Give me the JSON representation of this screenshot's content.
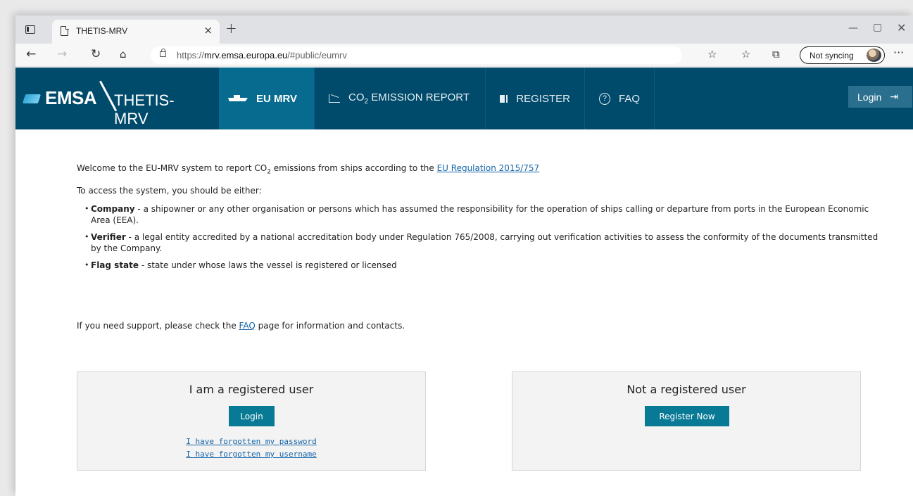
{
  "browser": {
    "tab_title": "THETIS-MRV",
    "tab_close": "×",
    "new_tab": "+",
    "url_prefix": "https://",
    "url_domain": "mrv.emsa.europa.eu",
    "url_path": "/#public/eumrv",
    "sync_label": "Not syncing",
    "icons": [
      "tab-actions-icon",
      "page-icon",
      "back-icon",
      "forward-icon",
      "refresh-icon",
      "home-icon",
      "lock-icon",
      "add-favorite-icon",
      "favorites-icon",
      "collections-icon",
      "more-icon"
    ]
  },
  "header": {
    "logo_text": "EMSA",
    "app_name": "THETIS-MRV",
    "menu": [
      {
        "label": "EU MRV",
        "active": true
      },
      {
        "label_main": "CO",
        "label_sub": "2",
        "label_rest": " EMISSION REPORT"
      },
      {
        "label": "REGISTER"
      },
      {
        "label": "FAQ"
      }
    ],
    "login_label": "Login",
    "brand_color": "#004a6b",
    "active_color": "#066b8f"
  },
  "content": {
    "welcome_pre": "Welcome to the EU-MRV system to report CO",
    "welcome_sub": "2",
    "welcome_post": " emissions from ships according to the ",
    "regulation_link": "EU Regulation 2015/757",
    "access_text": "To access the system, you should be either:",
    "roles": [
      {
        "name": "Company",
        "desc": " - a shipowner or any other organisation or persons which has assumed the responsibility for the operation of ships calling or departure from ports in the European Economic Area (EEA)."
      },
      {
        "name": "Verifier",
        "desc": " - a legal entity accredited by a national accreditation body under Regulation 765/2008, carrying out verification activities to assess the conformity of the documents transmitted by the Company."
      },
      {
        "name": "Flag state",
        "desc": " - state under whose laws the vessel is registered or licensed"
      }
    ],
    "support_pre": "If you need support, please check the ",
    "support_link": "FAQ",
    "support_post": " page for information and contacts."
  },
  "registered": {
    "title": "I am a registered user",
    "login_button": "Login",
    "forgot_password": "I have forgotten my password",
    "forgot_username": "I have forgotten my username"
  },
  "unregistered": {
    "title": "Not a registered user",
    "register_button": "Register Now"
  }
}
